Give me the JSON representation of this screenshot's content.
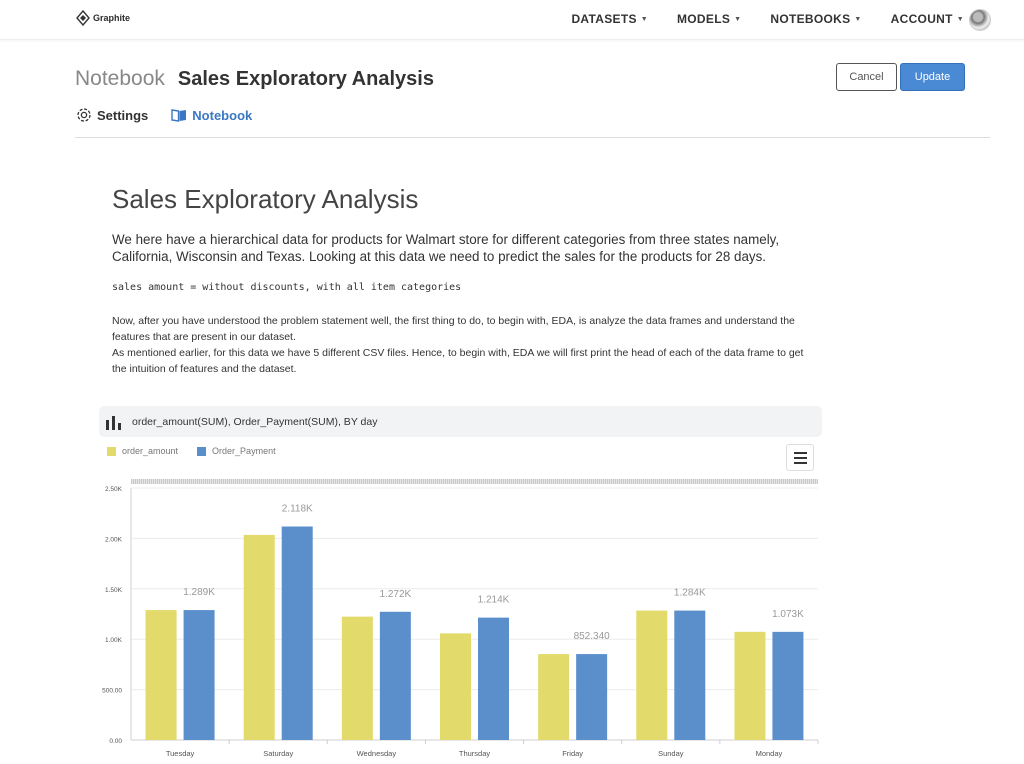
{
  "brand": {
    "name": "Graphite"
  },
  "nav": {
    "items": [
      {
        "label": "DATASETS"
      },
      {
        "label": "MODELS"
      },
      {
        "label": "NOTEBOOKS"
      },
      {
        "label": "ACCOUNT"
      }
    ]
  },
  "header": {
    "section": "Notebook",
    "title": "Sales Exploratory Analysis",
    "cancel_label": "Cancel",
    "update_label": "Update",
    "accent_color": "#4a89d4"
  },
  "tabs": [
    {
      "label": "Settings",
      "icon": "gear-icon"
    },
    {
      "label": "Notebook",
      "icon": "book-icon",
      "active": true
    }
  ],
  "doc": {
    "title": "Sales Exploratory Analysis",
    "intro": "We here have a hierarchical data for products for Walmart store for different categories from three states namely, California, Wisconsin and Texas. Looking at this data we need to predict the sales for the products for 28 days.",
    "code": "sales amount = without discounts, with all item categories",
    "para1": "Now, after you have understood the problem statement well, the first thing to do, to begin with, EDA, is analyze the data frames and understand the features that are present in our dataset.",
    "para2": "As mentioned earlier, for this data we have 5 different CSV files. Hence, to begin with, EDA we will first print the head of each of the data frame to get the intuition of features and the dataset."
  },
  "chart_card": {
    "title": "order_amount(SUM), Order_Payment(SUM), BY day",
    "icon": "bar-chart-icon"
  },
  "chart_data": {
    "type": "bar",
    "categories": [
      "Tuesday",
      "Saturday",
      "Wednesday",
      "Thursday",
      "Friday",
      "Sunday",
      "Monday"
    ],
    "series": [
      {
        "name": "order_amount",
        "color": "#e2da6b",
        "values": [
          1289,
          2035,
          1224,
          1058,
          852.34,
          1284,
          1073
        ]
      },
      {
        "name": "Order_Payment",
        "color": "#5b8fcc",
        "values": [
          1289,
          2118,
          1272,
          1214,
          852.34,
          1284,
          1073
        ]
      }
    ],
    "data_labels": [
      "1.289K",
      "2.118K",
      "1.272K",
      "1.214K",
      "852.340",
      "1.284K",
      "1.073K"
    ],
    "y_ticks": [
      "0.00",
      "500.00",
      "1.00K",
      "1.50K",
      "2.00K",
      "2.50K"
    ],
    "ylim": [
      0,
      2500
    ],
    "grid": true,
    "legend_position": "top-left"
  }
}
